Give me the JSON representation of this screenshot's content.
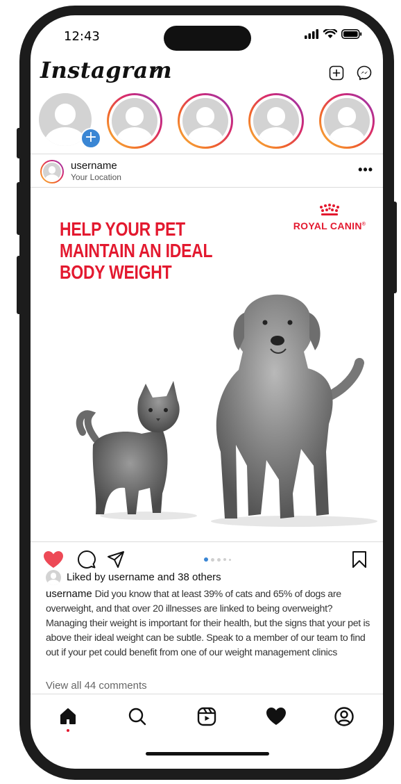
{
  "status_bar": {
    "time": "12:43"
  },
  "header": {
    "logo": "Instagram",
    "icons": [
      "new-post-icon",
      "messenger-icon"
    ]
  },
  "stories": [
    {
      "kind": "own",
      "icon": "add-story-icon"
    },
    {
      "kind": "story"
    },
    {
      "kind": "story"
    },
    {
      "kind": "story"
    },
    {
      "kind": "story"
    }
  ],
  "post": {
    "username": "username",
    "location": "Your Location",
    "ad": {
      "headline": [
        "HELP YOUR PET",
        "MAINTAIN AN IDEAL",
        "BODY WEIGHT"
      ],
      "brand": "ROYAL CANIN",
      "brand_mark": "®"
    },
    "carousel": {
      "count": 5,
      "active_index": 0
    },
    "liked": true,
    "likes_prefix": "Liked by",
    "likes_user": "username",
    "likes_suffix": "and",
    "likes_others": "38 others",
    "caption_user": "username",
    "caption": "Did you know that at least 39% of cats and 65% of dogs are overweight, and that over 20 illnesses are linked to being overweight? Managing their weight is important for their health, but the signs that your pet is above their ideal weight can be subtle. Speak to a member of our team to find out if your pet could benefit from one of our weight management clinics",
    "comments_link": "View all 44 comments"
  },
  "colors": {
    "brand_red": "#e3192f",
    "like_red": "#ed4956",
    "accent_blue": "#3a86d4",
    "story_ring": [
      "#f9c13a",
      "#f0632b",
      "#d6286f",
      "#8a3ab9"
    ]
  },
  "bottom_nav": [
    {
      "icon": "home-icon",
      "active": true
    },
    {
      "icon": "search-icon"
    },
    {
      "icon": "reels-icon"
    },
    {
      "icon": "activity-heart-icon"
    },
    {
      "icon": "profile-icon"
    }
  ]
}
